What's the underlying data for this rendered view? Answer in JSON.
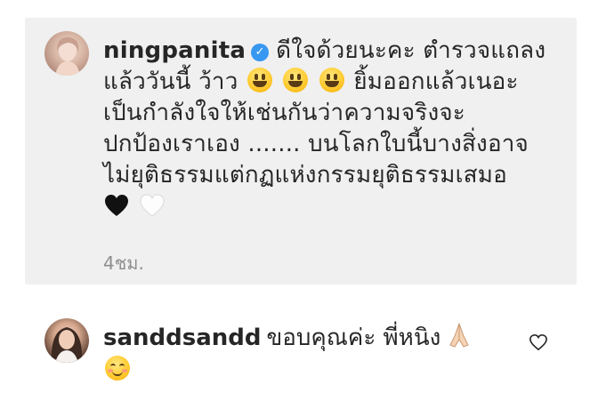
{
  "comment": {
    "username": "ningpanita",
    "verified": true,
    "line1": "ดีใจด้วยนะคะ ตำรวจแถลง",
    "line2_text": "แล้ววันนี้ ว้าว",
    "line2_tail": "ยิ้มออกแล้วเนอะ",
    "line3": "เป็นกำลังใจให้เช่นกันว่าความจริงจะ",
    "line4": "ปกป้องเราเอง ....... บนโลกใบนี้บางสิ่งอาจ",
    "line5": "ไม่ยุติธรรมแต่กฏแห่งกรรมยุติธรรมเสมอ",
    "emojis_line2": [
      "grinning-face",
      "grinning-face",
      "grinning-face"
    ],
    "emojis_line6": [
      "black-heart",
      "white-heart"
    ],
    "time": "4ชม."
  },
  "reply": {
    "username": "sanddsandd",
    "text": "ขอบคุณค่ะ พี่หนิง",
    "emojis": [
      "folded-hands",
      "smiling-face-with-smiling-eyes"
    ]
  },
  "colors": {
    "card_background": "#f0f0f0",
    "verified_badge": "#3897f0",
    "timestamp": "#8e8e8e"
  }
}
